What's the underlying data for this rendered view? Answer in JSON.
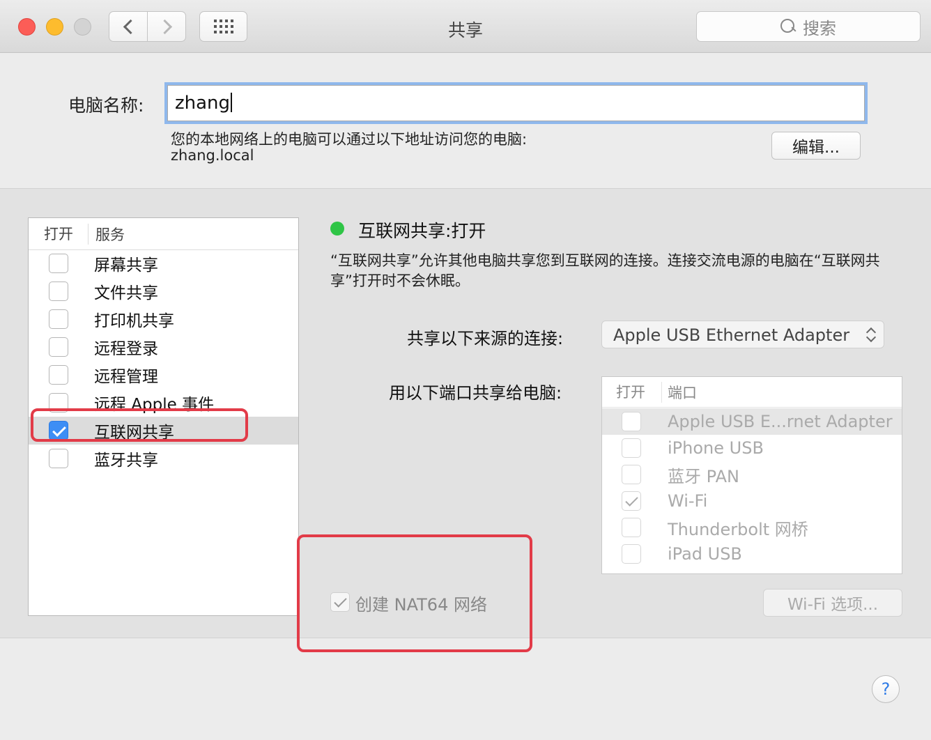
{
  "window": {
    "title": "共享"
  },
  "toolbar": {
    "search_placeholder": "搜索"
  },
  "computer_name": {
    "label": "电脑名称:",
    "value": "zhang",
    "address_desc": "您的本地网络上的电脑可以通过以下地址访问您的电脑:",
    "address": "zhang.local",
    "edit_label": "编辑..."
  },
  "services": {
    "header_on": "打开",
    "header_service": "服务",
    "items": [
      {
        "label": "屏幕共享",
        "checked": false,
        "selected": false
      },
      {
        "label": "文件共享",
        "checked": false,
        "selected": false
      },
      {
        "label": "打印机共享",
        "checked": false,
        "selected": false
      },
      {
        "label": "远程登录",
        "checked": false,
        "selected": false
      },
      {
        "label": "远程管理",
        "checked": false,
        "selected": false
      },
      {
        "label": "远程 Apple 事件",
        "checked": false,
        "selected": false
      },
      {
        "label": "互联网共享",
        "checked": true,
        "selected": true
      },
      {
        "label": "蓝牙共享",
        "checked": false,
        "selected": false
      }
    ]
  },
  "detail": {
    "status_color": "#2fc546",
    "status": "互联网共享:打开",
    "description": "“互联网共享”允许其他电脑共享您到互联网的连接。连接交流电源的电脑在“互联网共享”打开时不会休眠。",
    "source_label": "共享以下来源的连接:",
    "source_value": "Apple USB Ethernet Adapter",
    "ports_label": "用以下端口共享给电脑:",
    "ports_header_on": "打开",
    "ports_header_port": "端口",
    "ports": [
      {
        "label": "Apple USB E...rnet Adapter",
        "checked": false,
        "selected": true
      },
      {
        "label": "iPhone USB",
        "checked": false,
        "selected": false
      },
      {
        "label": "蓝牙 PAN",
        "checked": false,
        "selected": false
      },
      {
        "label": "Wi-Fi",
        "checked": true,
        "selected": false
      },
      {
        "label": "Thunderbolt 网桥",
        "checked": false,
        "selected": false
      },
      {
        "label": "iPad USB",
        "checked": false,
        "selected": false
      }
    ],
    "nat64_label": "创建 NAT64 网络",
    "nat64_checked": true,
    "wifi_options_label": "Wi-Fi 选项..."
  },
  "help": {
    "label": "?"
  },
  "colors": {
    "annotation": "#e23b48",
    "accent": "#3d8ef5"
  }
}
